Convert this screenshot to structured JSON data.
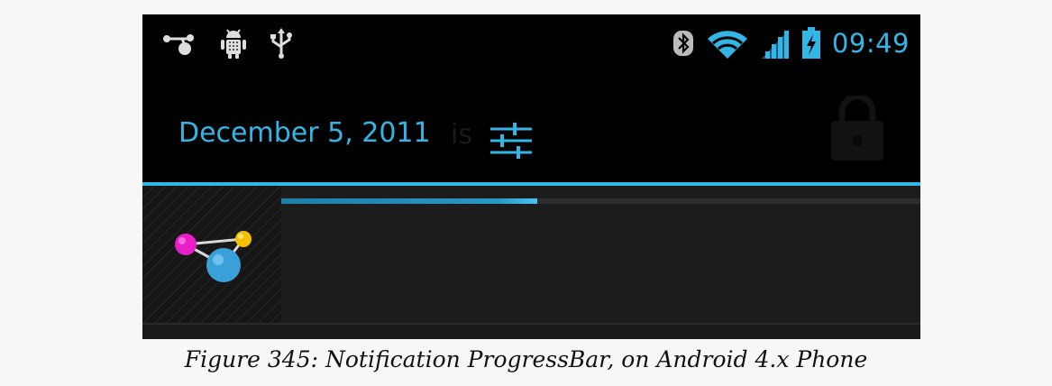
{
  "status_bar": {
    "left_icons": [
      "usb-connection-icon",
      "android-debug-icon",
      "usb-icon"
    ],
    "right_icons": [
      "bluetooth-icon",
      "wifi-icon",
      "signal-icon",
      "battery-charging-icon"
    ],
    "clock": "09:49"
  },
  "header": {
    "date": "December 5, 2011",
    "settings_icon": "quick-settings-icon"
  },
  "notification": {
    "icon": "molecule-app-icon",
    "progress": 0.4
  },
  "caption": "Figure 345: Notification ProgressBar, on Android 4.x Phone",
  "colors": {
    "accent": "#33b5e5",
    "background": "#000000",
    "notification_bg": "#1c1c1c"
  }
}
